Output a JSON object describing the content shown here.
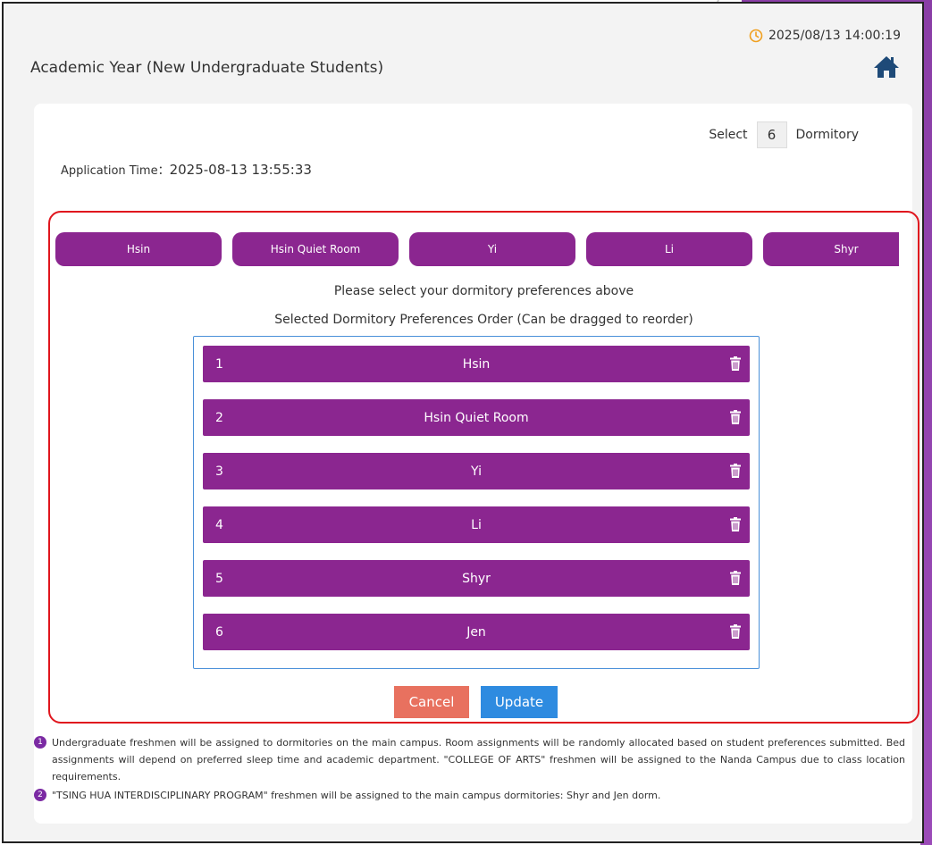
{
  "header": {
    "datetime": "2025/08/13 14:00:19",
    "title": "Academic Year (New Undergraduate Students)"
  },
  "selection": {
    "select_label": "Select",
    "count": "6",
    "dormitory_label": "Dormitory"
  },
  "application": {
    "label": "Application Time：",
    "value": "2025-08-13 13:55:33"
  },
  "dorm_options": [
    "Hsin",
    "Hsin Quiet Room",
    "Yi",
    "Li",
    "Shyr"
  ],
  "hint_select": "Please select your dormitory preferences above",
  "hint_order": "Selected Dormitory Preferences Order (Can be dragged to reorder)",
  "preferences": [
    {
      "rank": "1",
      "name": "Hsin"
    },
    {
      "rank": "2",
      "name": "Hsin Quiet Room"
    },
    {
      "rank": "3",
      "name": "Yi"
    },
    {
      "rank": "4",
      "name": "Li"
    },
    {
      "rank": "5",
      "name": "Shyr"
    },
    {
      "rank": "6",
      "name": "Jen"
    }
  ],
  "buttons": {
    "cancel": "Cancel",
    "update": "Update"
  },
  "notes": [
    {
      "badge": "1",
      "text": "Undergraduate freshmen will be assigned to dormitories on the main campus. Room assignments will be randomly allocated based on student preferences submitted. Bed assignments will depend on preferred sleep time and academic department. \"COLLEGE OF ARTS\" freshmen will be assigned to the Nanda Campus due to class location requirements."
    },
    {
      "badge": "2",
      "text": "\"TSING HUA INTERDISCIPLINARY PROGRAM\" freshmen will be assigned to the main campus dormitories: Shyr and Jen dorm."
    }
  ],
  "colors": {
    "accent_purple": "#8b2690",
    "border_red": "#e0161e",
    "cancel": "#e8715f",
    "update": "#2e8be0",
    "clock": "#f0a020",
    "home": "#1e4a78"
  },
  "icons": {
    "clock": "clock-icon",
    "home": "home-icon",
    "trash": "trash-icon",
    "note_badge": "number-badge-icon"
  }
}
